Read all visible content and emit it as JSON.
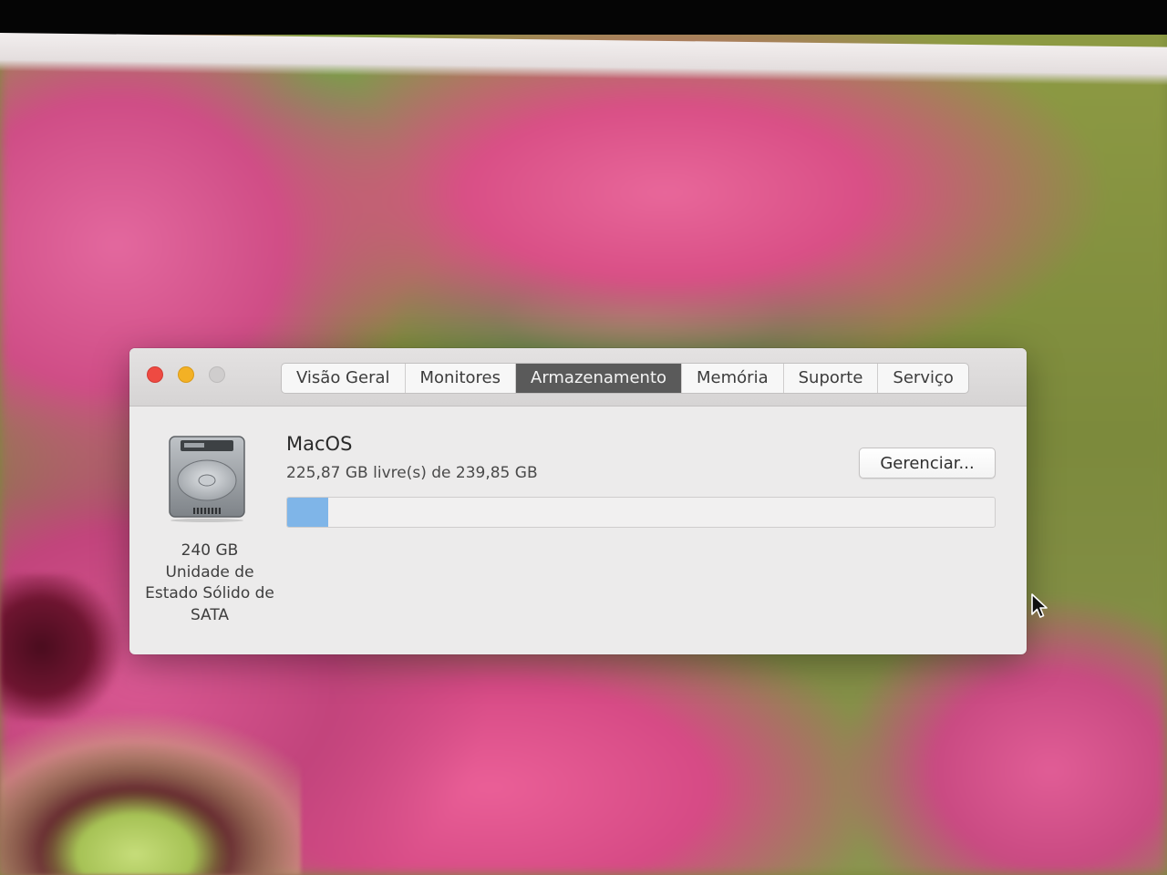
{
  "window": {
    "tabs": [
      {
        "label": "Visão Geral",
        "active": false
      },
      {
        "label": "Monitores",
        "active": false
      },
      {
        "label": "Armazenamento",
        "active": true
      },
      {
        "label": "Memória",
        "active": false
      },
      {
        "label": "Suporte",
        "active": false
      },
      {
        "label": "Serviço",
        "active": false
      }
    ]
  },
  "disk": {
    "capacity": "240 GB",
    "type_line1": "Unidade de",
    "type_line2": "Estado Sólido de",
    "type_line3": "SATA",
    "icon": "hard-drive-icon"
  },
  "volume": {
    "name": "MacOS",
    "free_text": "225,87 GB livre(s) de 239,85 GB",
    "used_fraction": 0.0583
  },
  "buttons": {
    "manage_label": "Gerenciar..."
  },
  "colors": {
    "active_tab": "#5a5a5a",
    "used_storage": "#7fb5e8",
    "close": "#ee4a42",
    "minimize": "#f3b125"
  }
}
